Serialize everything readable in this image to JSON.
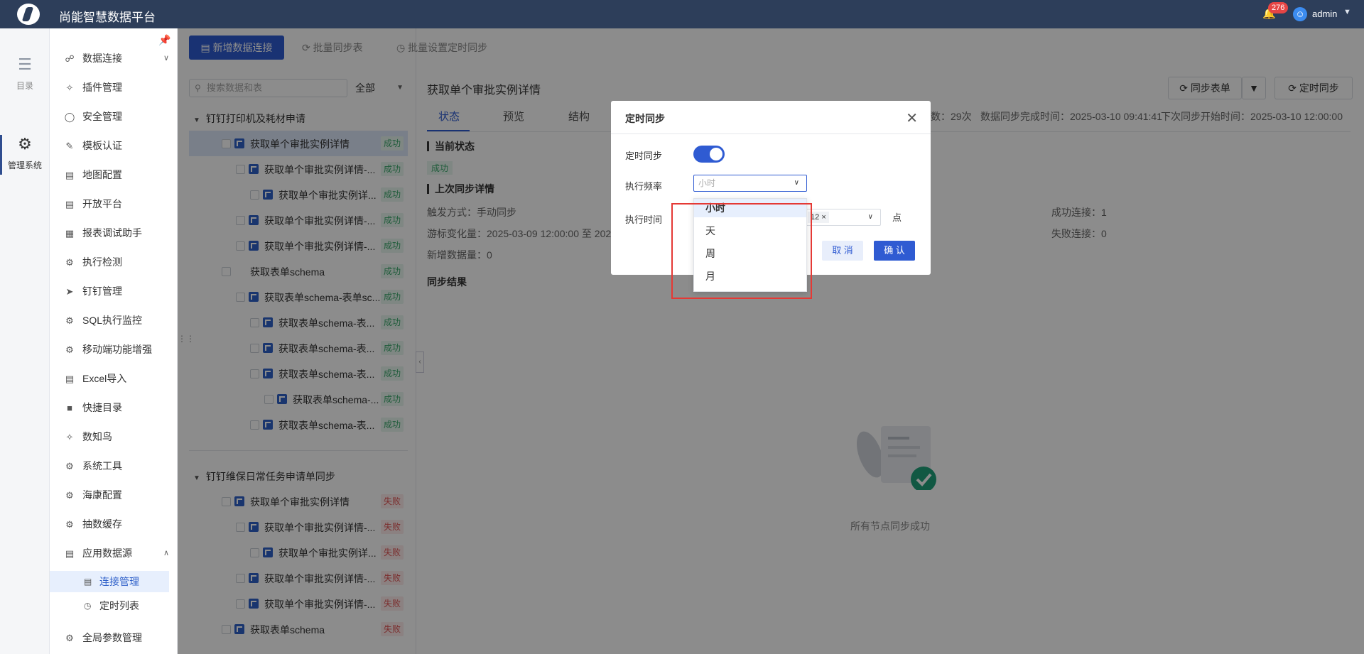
{
  "header": {
    "app_title": "尚能智慧数据平台",
    "notification_count": "276",
    "user": "admin"
  },
  "rail": {
    "items": [
      {
        "label": "目录",
        "icon": "list-icon"
      },
      {
        "label": "管理系统",
        "icon": "gear-icon"
      }
    ]
  },
  "menu": {
    "items": [
      {
        "label": "数据连接",
        "icon": "link-icon"
      },
      {
        "label": "插件管理",
        "icon": "plugin-icon"
      },
      {
        "label": "安全管理",
        "icon": "shield-icon"
      },
      {
        "label": "模板认证",
        "icon": "template-icon"
      },
      {
        "label": "地图配置",
        "icon": "map-icon"
      },
      {
        "label": "开放平台",
        "icon": "platform-icon"
      },
      {
        "label": "报表调试助手",
        "icon": "calendar-icon"
      },
      {
        "label": "执行检测",
        "icon": "gear-icon"
      },
      {
        "label": "钉钉管理",
        "icon": "dingtalk-icon"
      },
      {
        "label": "SQL执行监控",
        "icon": "gear-icon"
      },
      {
        "label": "移动端功能增强",
        "icon": "gear-icon"
      },
      {
        "label": "Excel导入",
        "icon": "excel-icon"
      },
      {
        "label": "快捷目录",
        "icon": "folder-icon"
      },
      {
        "label": "数知鸟",
        "icon": "plugin-icon"
      },
      {
        "label": "系统工具",
        "icon": "tools-icon"
      },
      {
        "label": "海康配置",
        "icon": "gear-icon"
      },
      {
        "label": "抽数缓存",
        "icon": "gear-icon"
      },
      {
        "label": "应用数据源",
        "icon": "datasource-icon"
      },
      {
        "label": "全局参数管理",
        "icon": "gear-icon"
      }
    ],
    "sub": [
      {
        "label": "连接管理",
        "icon": "connection-icon"
      },
      {
        "label": "定时列表",
        "icon": "clock-icon"
      }
    ]
  },
  "toolbar": {
    "add": "新增数据连接",
    "batch_sync": "批量同步表",
    "batch_timer": "批量设置定时同步"
  },
  "left_panel": {
    "search_placeholder": "搜索数据和表",
    "filter": "全部",
    "groups": [
      {
        "name": "钉钉打印机及耗材申请",
        "rows": [
          {
            "label": "获取单个审批实例详情",
            "status": "成功"
          },
          {
            "label": "获取单个审批实例详情-...",
            "status": "成功"
          },
          {
            "label": "获取单个审批实例详...",
            "status": "成功"
          },
          {
            "label": "获取单个审批实例详情-...",
            "status": "成功"
          },
          {
            "label": "获取单个审批实例详情-...",
            "status": "成功"
          },
          {
            "label": "获取表单schema",
            "status": "成功"
          },
          {
            "label": "获取表单schema-表单sc...",
            "status": "成功"
          },
          {
            "label": "获取表单schema-表...",
            "status": "成功"
          },
          {
            "label": "获取表单schema-表...",
            "status": "成功"
          },
          {
            "label": "获取表单schema-表...",
            "status": "成功"
          },
          {
            "label": "获取表单schema-...",
            "status": "成功"
          },
          {
            "label": "获取表单schema-表...",
            "status": "成功"
          }
        ]
      },
      {
        "name": "钉钉维保日常任务申请单同步",
        "rows": [
          {
            "label": "获取单个审批实例详情",
            "status": "失败"
          },
          {
            "label": "获取单个审批实例详情-...",
            "status": "失败"
          },
          {
            "label": "获取单个审批实例详...",
            "status": "失败"
          },
          {
            "label": "获取单个审批实例详情-...",
            "status": "失败"
          },
          {
            "label": "获取单个审批实例详情-...",
            "status": "失败"
          },
          {
            "label": "获取表单schema",
            "status": "失败"
          }
        ]
      }
    ]
  },
  "right_panel": {
    "title": "获取单个审批实例详情",
    "sync_table_btn": "同步表单",
    "timer_sync_btn": "定时同步",
    "tabs": [
      "状态",
      "预览",
      "结构"
    ],
    "stats": {
      "count": "数：29次",
      "finish_time": "数据同步完成时间：2025-03-10 09:41:41",
      "next_time": "下次同步开始时间：2025-03-10 12:00:00"
    },
    "current_state_title": "当前状态",
    "current_state": "成功",
    "last_sync_title": "上次同步详情",
    "trigger": "触发方式：手动同步",
    "cursor": "游标变化量：2025-03-09 12:00:00 至 2025",
    "new_count": "新增数据量：0",
    "success_conn": "成功连接：1",
    "fail_conn": "失败连接：0",
    "result_title": "同步结果",
    "empty_text": "所有节点同步成功"
  },
  "dialog": {
    "title": "定时同步",
    "label_timer": "定时同步",
    "label_freq": "执行频率",
    "freq_placeholder": "小时",
    "label_time": "执行时间",
    "time_tag": "12",
    "time_unit": "点",
    "cancel": "取 消",
    "confirm": "确 认",
    "options": [
      "小时",
      "天",
      "周",
      "月"
    ]
  },
  "colors": {
    "primary": "#2f5bd2",
    "header_bg": "#2d3e5a",
    "success": "#3aa86b",
    "fail": "#e05555",
    "highlight": "#e53935"
  }
}
